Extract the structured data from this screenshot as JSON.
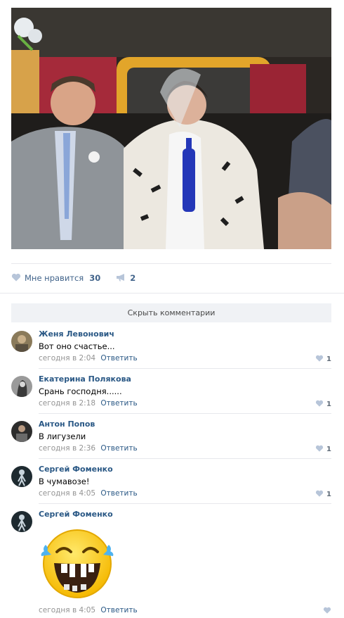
{
  "post": {
    "likes_label": "Мне нравится",
    "likes_count": "30",
    "shares_count": "2",
    "hide_comments": "Скрыть комментарии"
  },
  "comments": [
    {
      "author": "Женя Левонович",
      "text": "Вот оно счастье...",
      "time": "сегодня в 2:04",
      "reply": "Ответить",
      "likes": "1"
    },
    {
      "author": "Екатерина Полякова",
      "text": "Срань господня......",
      "time": "сегодня в 2:18",
      "reply": "Ответить",
      "likes": "1"
    },
    {
      "author": "Антон Попов",
      "text": "В лигузели",
      "time": "сегодня в 2:36",
      "reply": "Ответить",
      "likes": "1"
    },
    {
      "author": "Сергей Фоменко",
      "text": "В чумавозе!",
      "time": "сегодня в 4:05",
      "reply": "Ответить",
      "likes": "1"
    },
    {
      "author": "Сергей Фоменко",
      "time": "сегодня в 4:05",
      "reply": "Ответить"
    }
  ],
  "colors": {
    "link": "#2a5885",
    "like_icon": "#b7c5d9",
    "separator": "#e7e8ec"
  }
}
